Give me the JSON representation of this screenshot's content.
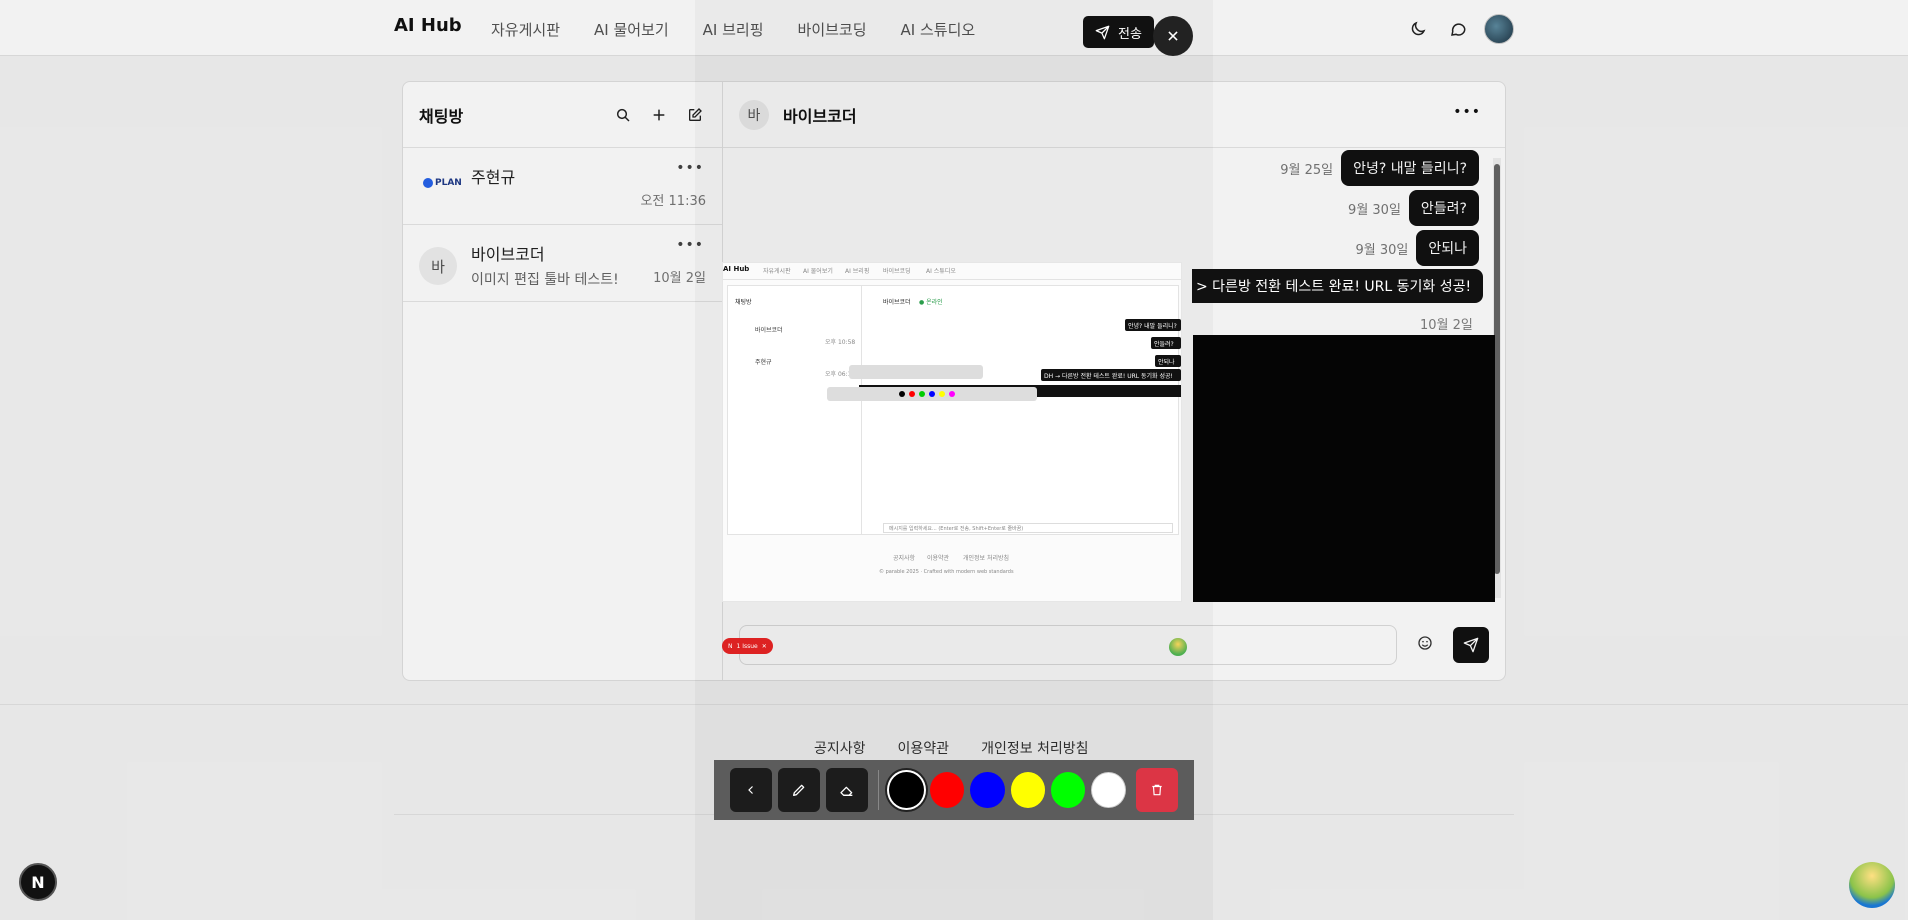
{
  "nav": {
    "brand": "AI Hub",
    "links": [
      "자유게시판",
      "AI 물어보기",
      "AI 브리핑",
      "바이브코딩",
      "AI 스튜디오"
    ]
  },
  "sidebar": {
    "title": "채팅방",
    "rooms": [
      {
        "name": "주현규",
        "preview": "",
        "time": "오전 11:36",
        "avatar_text": "PLAN"
      },
      {
        "name": "바이브코더",
        "preview": "이미지 편집 툴바 테스트!",
        "time": "10월 2일",
        "avatar_text": "바"
      }
    ]
  },
  "chat": {
    "avatar_text": "바",
    "title": "바이브코더",
    "messages": [
      {
        "time": "9월 25일",
        "text": "안녕? 내말 들리니?"
      },
      {
        "time": "9월 30일",
        "text": "안들려?"
      },
      {
        "time": "9월 30일",
        "text": "안되나"
      },
      {
        "time": "10월 2일",
        "text": "> 다른방 전환 테스트 완료! URL 동기화 성공!"
      }
    ],
    "input_placeholder": ""
  },
  "footer": {
    "links": [
      "공지사항",
      "이용약관",
      "개인정보 처리방침"
    ]
  },
  "editor": {
    "send_label": "전송",
    "issue_label": "1 Issue",
    "issue_mark": "N",
    "colors": [
      "#000000",
      "#ff0000",
      "#0000ff",
      "#ffff00",
      "#00ff00",
      "#ffffff"
    ],
    "selected_color": "#000000",
    "trash_color": "#dc3545"
  },
  "mini_shot": {
    "brand": "AI Hub",
    "links": [
      "자유게시판",
      "AI 물어보기",
      "AI 브리핑",
      "바이브코딩",
      "AI 스튜디오"
    ],
    "sidebar_title": "채팅방",
    "room1": "바이브코더",
    "room1_time": "오후 10:58",
    "room2": "주현규",
    "room2_time": "오후 06:18",
    "chat_title": "바이브코더",
    "chat_status": "● 온라인",
    "bubbles": [
      "안녕? 내말 들리니?",
      "안들려?",
      "안되나"
    ],
    "long_bubble": "DH → 다른방 전환 테스트 완료! URL 동기화 성공!",
    "input_hint": "메시지를 입력하세요... (Enter로 전송, Shift+Enter로 줄바꿈)",
    "footer_links": [
      "공지사항",
      "이용약관",
      "개인정보 처리방침"
    ],
    "copyright": "© parable 2025 · Crafted with modern web standards"
  },
  "badge": {
    "label": "N"
  }
}
